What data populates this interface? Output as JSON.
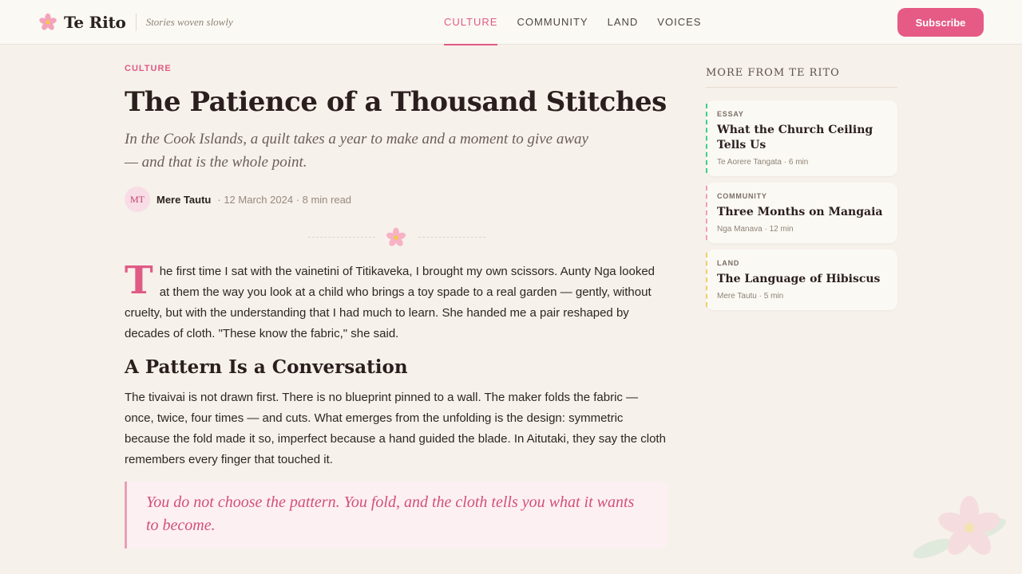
{
  "header": {
    "brand_name": "Te Rito",
    "tagline": "Stories woven slowly",
    "nav": [
      {
        "label": "CULTURE",
        "active": true
      },
      {
        "label": "COMMUNITY",
        "active": false
      },
      {
        "label": "LAND",
        "active": false
      },
      {
        "label": "VOICES",
        "active": false
      }
    ],
    "subscribe_label": "Subscribe"
  },
  "colors": {
    "accent": "#e05a86",
    "background": "#f6f1ea",
    "header_bg": "#fbf9f4"
  },
  "article": {
    "kicker": "CULTURE",
    "title": "The Patience of a Thousand Stitches",
    "dek": "In the Cook Islands, a quilt takes a year to make and a moment to give away — and that is the whole point.",
    "author_initials": "MT",
    "author": "Mere Tautu",
    "meta": "· 12 March 2024 · 8 min read",
    "dropcap": "T",
    "para1": "he first time I sat with the vainetini of Titikaveka, I brought my own scissors. Aunty Nga looked at them the way you look at a child who brings a toy spade to a real garden — gently, without cruelty, but with the understanding that I had much to learn. She handed me a pair reshaped by decades of cloth. \"These know the fabric,\" she said.",
    "heading2": "A Pattern Is a Conversation",
    "para2": "The tivaivai is not drawn first. There is no blueprint pinned to a wall. The maker folds the fabric — once, twice, four times — and cuts. What emerges from the unfolding is the design: symmetric because the fold made it so, imperfect because a hand guided the blade. In Aitutaki, they say the cloth remembers every finger that touched it.",
    "quote": "You do not choose the pattern. You fold, and the cloth tells you what it wants to become."
  },
  "sidebar": {
    "heading": "MORE FROM TE RITO",
    "cards": [
      {
        "tag": "ESSAY",
        "title": "What the Church Ceiling Tells Us",
        "meta": "Te Aorere Tangata · 6 min",
        "accent": "#3fcf8e"
      },
      {
        "tag": "COMMUNITY",
        "title": "Three Months on Mangaia",
        "meta": "Nga Manava · 12 min",
        "accent": "#f0a0b4"
      },
      {
        "tag": "LAND",
        "title": "The Language of Hibiscus",
        "meta": "Mere Tautu · 5 min",
        "accent": "#f2d06b"
      }
    ]
  },
  "icons": {
    "logo": "hibiscus-flower-icon",
    "divider": "flower-icon"
  }
}
